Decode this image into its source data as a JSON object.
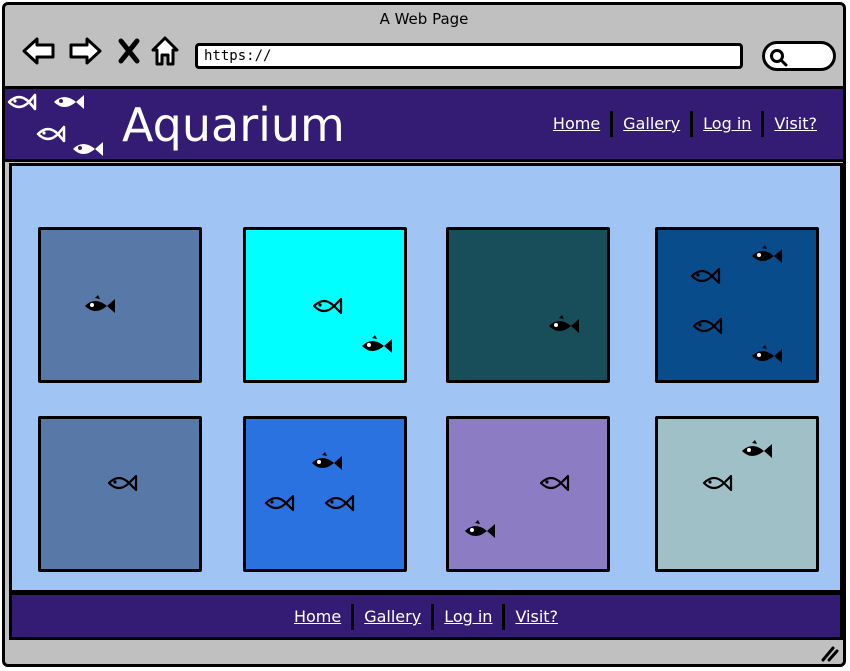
{
  "browser": {
    "title": "A Web Page",
    "url": "https://"
  },
  "site": {
    "brand": "Aquarium",
    "nav": [
      "Home",
      "Gallery",
      "Log in",
      "Visit?"
    ],
    "footer_nav": [
      "Home",
      "Gallery",
      "Log in",
      "Visit?"
    ],
    "header_color": "#341c74",
    "content_bg": "#a0c4f4"
  },
  "gallery": {
    "tiles": [
      {
        "color": "#5878a8",
        "fish": [
          "solid"
        ]
      },
      {
        "color": "#00ffff",
        "fish": [
          "outline",
          "solid"
        ]
      },
      {
        "color": "#174e5a",
        "fish": [
          "solid"
        ]
      },
      {
        "color": "#084c8c",
        "fish": [
          "outline",
          "solid",
          "outline",
          "solid"
        ]
      },
      {
        "color": "#5878a8",
        "fish": [
          "outline"
        ]
      },
      {
        "color": "#2a72e0",
        "fish": [
          "solid",
          "outline",
          "outline"
        ]
      },
      {
        "color": "#8c7cc4",
        "fish": [
          "outline",
          "solid"
        ]
      },
      {
        "color": "#a0c0c8",
        "fish": [
          "solid",
          "outline"
        ]
      }
    ]
  }
}
